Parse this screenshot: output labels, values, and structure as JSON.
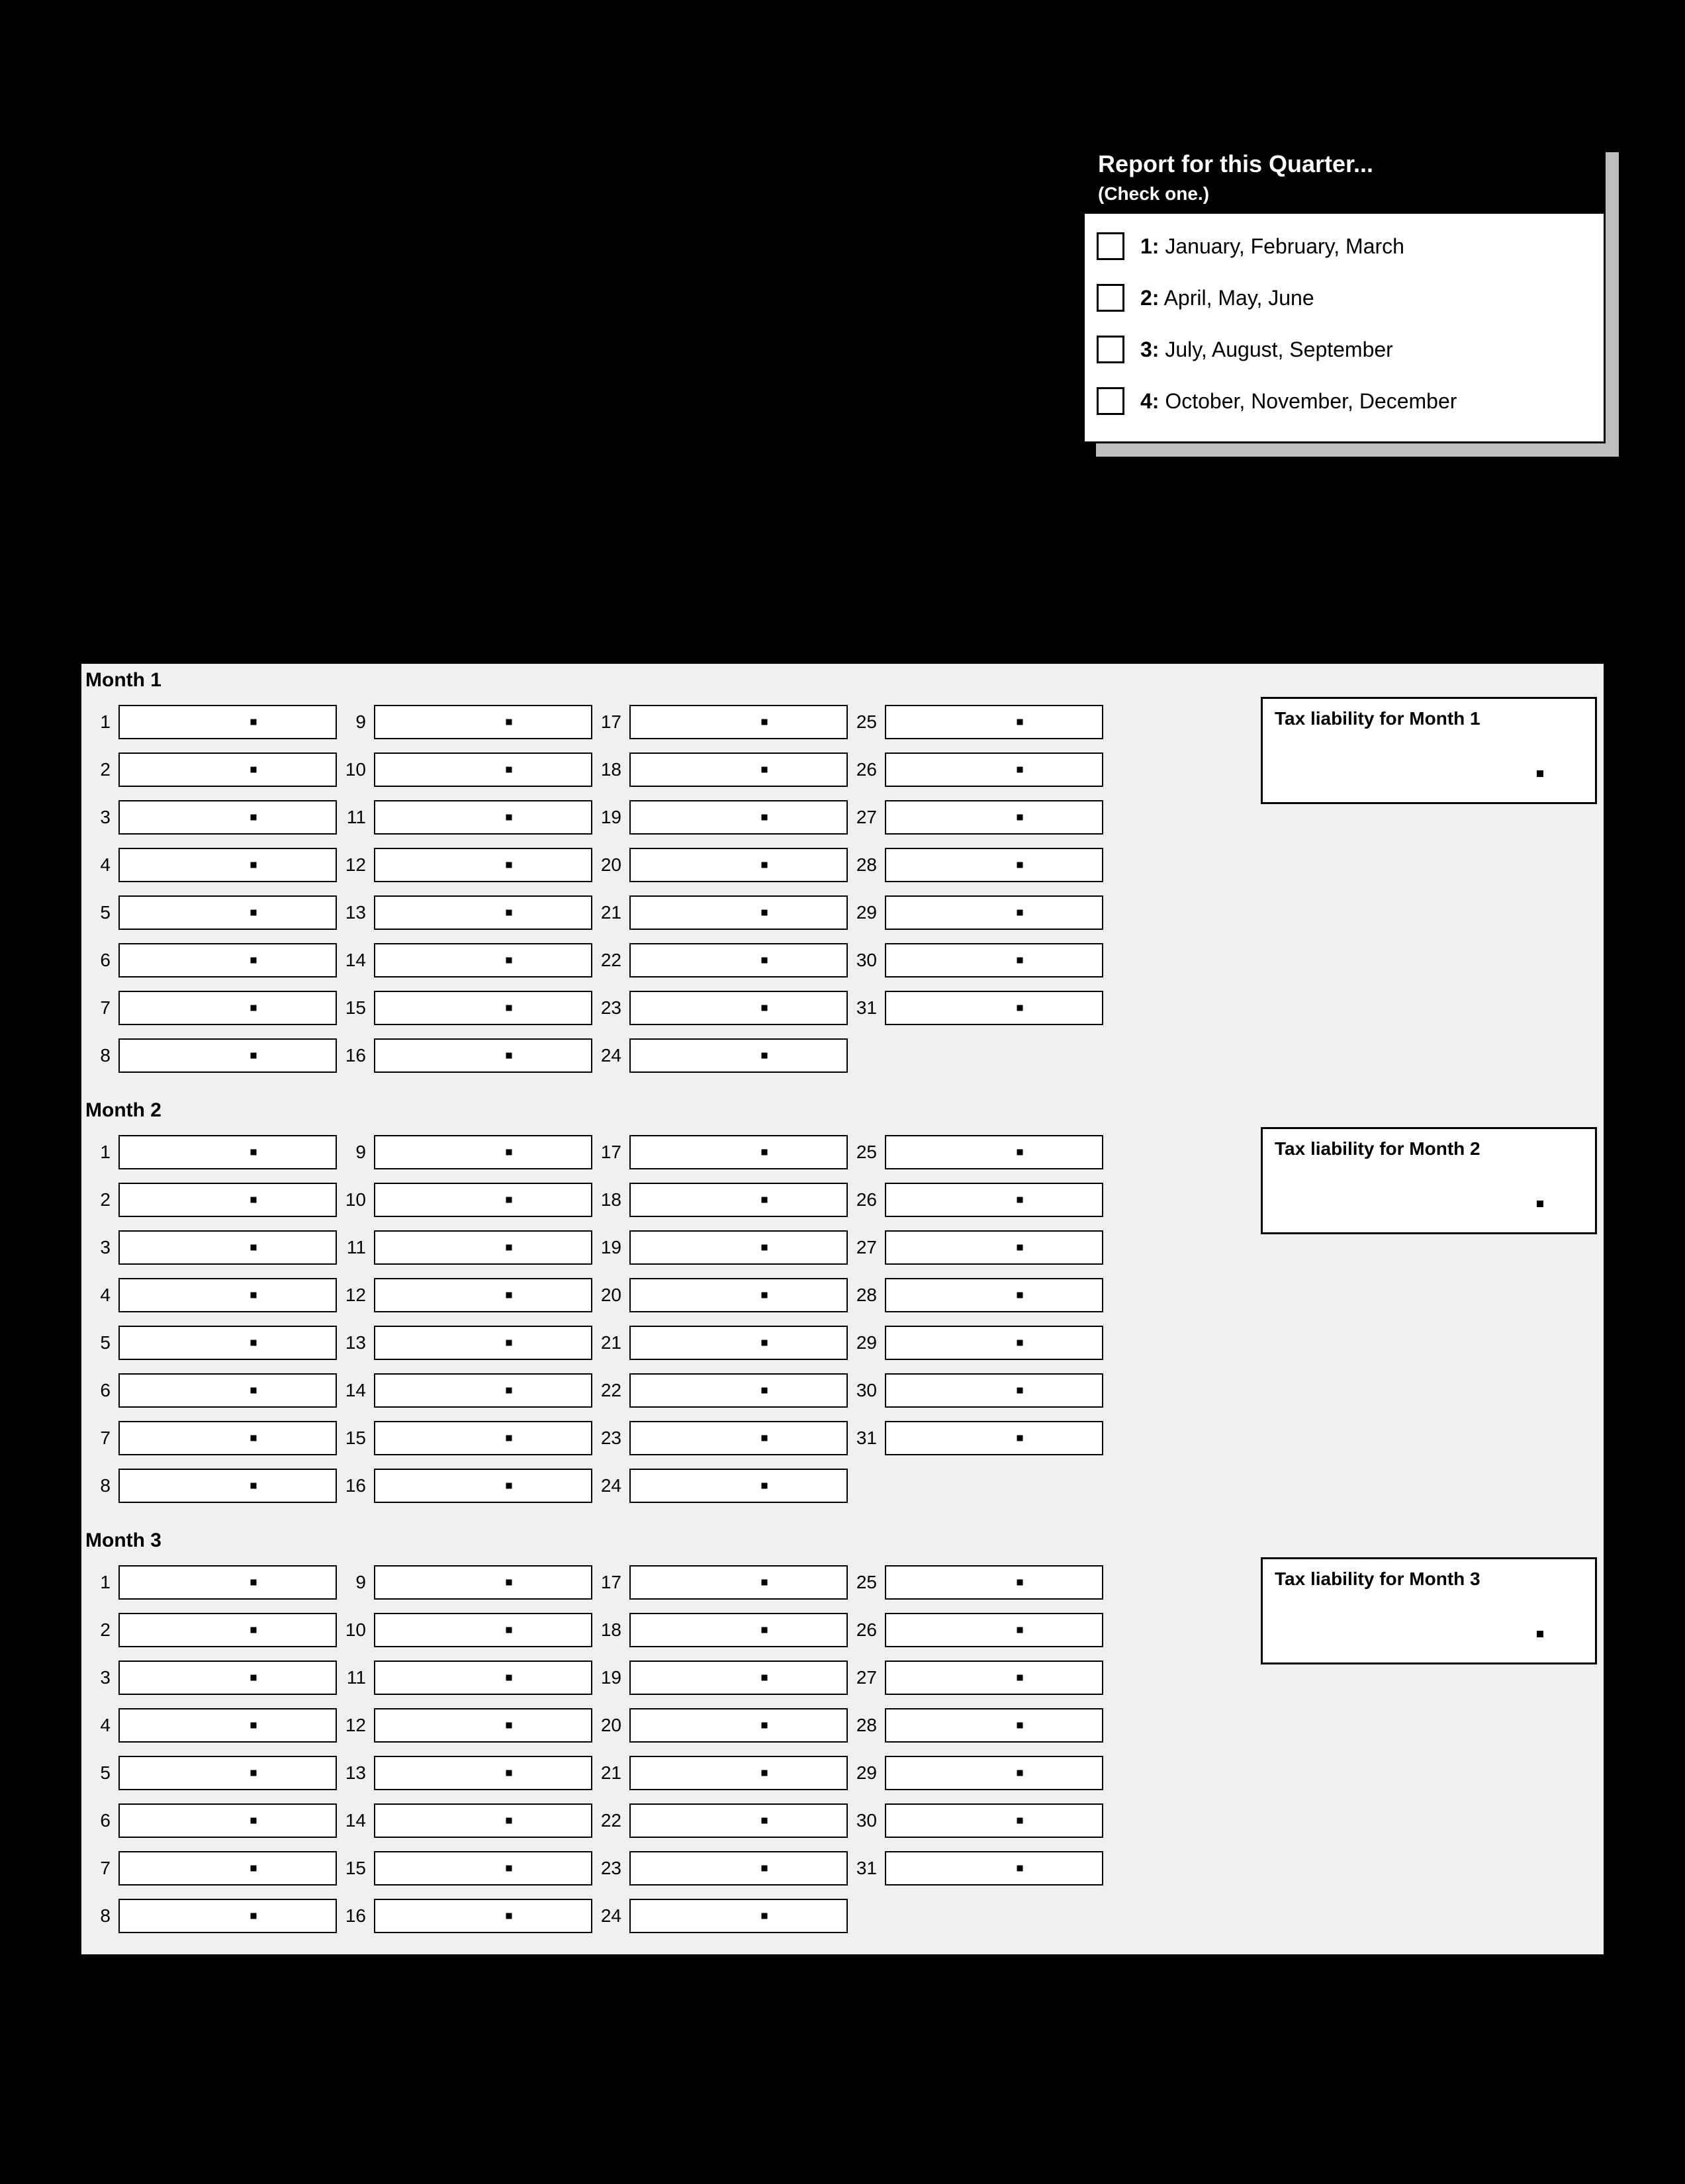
{
  "quarter_box": {
    "title": "Report for this Quarter...",
    "subtitle": "(Check one.)",
    "options": [
      {
        "num": "1:",
        "text": " January, February, March"
      },
      {
        "num": "2:",
        "text": " April, May, June"
      },
      {
        "num": "3:",
        "text": " July, August, September"
      },
      {
        "num": "4:",
        "text": " October, November, December"
      }
    ]
  },
  "months": [
    {
      "title": "Month 1",
      "total_label": "Tax liability for Month 1"
    },
    {
      "title": "Month 2",
      "total_label": "Tax liability for Month 2"
    },
    {
      "title": "Month 3",
      "total_label": "Tax liability for Month 3"
    }
  ],
  "columns": [
    [
      1,
      2,
      3,
      4,
      5,
      6,
      7,
      8
    ],
    [
      9,
      10,
      11,
      12,
      13,
      14,
      15,
      16
    ],
    [
      17,
      18,
      19,
      20,
      21,
      22,
      23,
      24
    ],
    [
      25,
      26,
      27,
      28,
      29,
      30,
      31
    ]
  ]
}
